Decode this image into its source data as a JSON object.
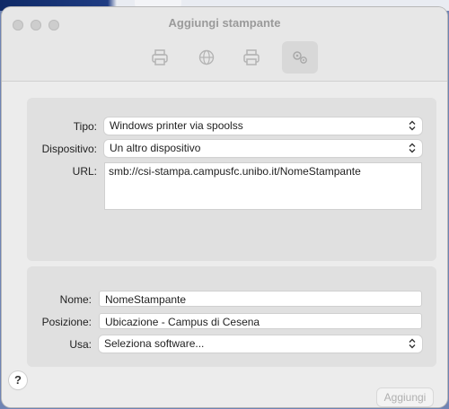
{
  "window": {
    "title": "Aggiungi stampante"
  },
  "toolbar": {
    "buttons": [
      {
        "icon": "printer-icon",
        "selected": false
      },
      {
        "icon": "globe-icon",
        "selected": false
      },
      {
        "icon": "printer-alt-icon",
        "selected": false
      },
      {
        "icon": "gears-icon",
        "selected": true
      }
    ]
  },
  "connection": {
    "type_label": "Tipo:",
    "type_value": "Windows printer via spoolss",
    "device_label": "Dispositivo:",
    "device_value": "Un altro dispositivo",
    "url_label": "URL:",
    "url_value": "smb://csi-stampa.campusfc.unibo.it/NomeStampante"
  },
  "printer": {
    "name_label": "Nome:",
    "name_value": "NomeStampante",
    "location_label": "Posizione:",
    "location_value": "Ubicazione - Campus di Cesena",
    "use_label": "Usa:",
    "use_value": "Seleziona software..."
  },
  "footer": {
    "help_label": "?",
    "add_label": "Aggiungi",
    "add_enabled": false
  }
}
